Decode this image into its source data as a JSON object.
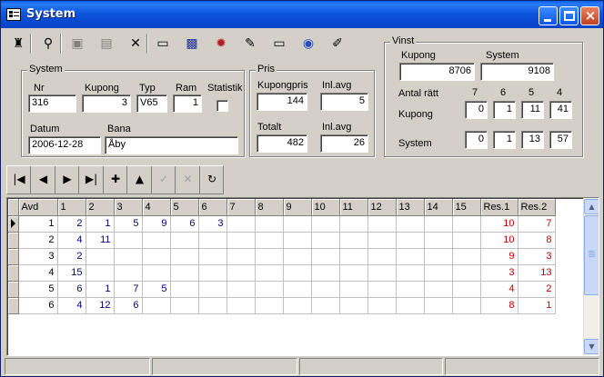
{
  "window": {
    "title": "System"
  },
  "toolbar": {
    "buttons": [
      {
        "name": "tool-icon",
        "glyph": "♜"
      },
      {
        "name": "binoculars-icon",
        "glyph": "⚲"
      },
      {
        "name": "save-icon",
        "glyph": "▣"
      },
      {
        "name": "print-icon",
        "glyph": "▤"
      },
      {
        "name": "delete-icon",
        "glyph": "✕"
      },
      {
        "name": "open-folder-icon",
        "glyph": "▭"
      },
      {
        "name": "settings-icon",
        "glyph": "▩"
      },
      {
        "name": "gear-icon",
        "glyph": "✹"
      },
      {
        "name": "pen-icon",
        "glyph": "✎"
      },
      {
        "name": "window-icon",
        "glyph": "▭"
      },
      {
        "name": "globe-icon",
        "glyph": "◉"
      },
      {
        "name": "tool2-icon",
        "glyph": "✐"
      }
    ]
  },
  "system_group": {
    "title": "System",
    "nr_label": "Nr",
    "nr_value": "316",
    "kupong_label": "Kupong",
    "kupong_value": "3",
    "typ_label": "Typ",
    "typ_value": "V65",
    "ram_label": "Ram",
    "ram_value": "1",
    "statistik_label": "Statistik",
    "datum_label": "Datum",
    "datum_value": "2006-12-28",
    "bana_label": "Bana",
    "bana_value": "Åby"
  },
  "pris_group": {
    "title": "Pris",
    "kupongpris_label": "Kupongpris",
    "kupongpris_value": "144",
    "inlavg1_label": "Inl.avg",
    "inlavg1_value": "5",
    "totalt_label": "Totalt",
    "totalt_value": "482",
    "inlavg2_label": "Inl.avg",
    "inlavg2_value": "26"
  },
  "vinst_group": {
    "title": "Vinst",
    "kupong_label": "Kupong",
    "kupong_value": "8706",
    "system_label": "System",
    "system_value": "9108",
    "antal_ratt_label": "Antal rätt",
    "col_headers": [
      "7",
      "6",
      "5",
      "4"
    ],
    "row_kupong_label": "Kupong",
    "row_kupong_values": [
      "0",
      "1",
      "11",
      "41"
    ],
    "row_system_label": "System",
    "row_system_values": [
      "0",
      "1",
      "13",
      "57"
    ]
  },
  "navigator": {
    "buttons": [
      {
        "name": "first-record-button",
        "glyph": "|◀"
      },
      {
        "name": "prior-record-button",
        "glyph": "◀"
      },
      {
        "name": "next-record-button",
        "glyph": "▶"
      },
      {
        "name": "last-record-button",
        "glyph": "▶|"
      },
      {
        "name": "insert-record-button",
        "glyph": "✚"
      },
      {
        "name": "delete-record-button",
        "glyph": "▲"
      },
      {
        "name": "post-record-button",
        "glyph": "✓"
      },
      {
        "name": "cancel-record-button",
        "glyph": "✕"
      },
      {
        "name": "refresh-record-button",
        "glyph": "↻"
      }
    ]
  },
  "grid": {
    "headers": [
      "Avd",
      "1",
      "2",
      "3",
      "4",
      "5",
      "6",
      "7",
      "8",
      "9",
      "10",
      "11",
      "12",
      "13",
      "14",
      "15",
      "Res.1",
      "Res.2"
    ],
    "rows": [
      [
        "1",
        "2",
        "1",
        "5",
        "9",
        "6",
        "3",
        "",
        "",
        "",
        "",
        "",
        "",
        "",
        "",
        "",
        "10",
        "7"
      ],
      [
        "2",
        "4",
        "11",
        "",
        "",
        "",
        "",
        "",
        "",
        "",
        "",
        "",
        "",
        "",
        "",
        "",
        "10",
        "8"
      ],
      [
        "3",
        "2",
        "",
        "",
        "",
        "",
        "",
        "",
        "",
        "",
        "",
        "",
        "",
        "",
        "",
        "",
        "9",
        "3"
      ],
      [
        "4",
        "15",
        "",
        "",
        "",
        "",
        "",
        "",
        "",
        "",
        "",
        "",
        "",
        "",
        "",
        "",
        "3",
        "13"
      ],
      [
        "5",
        "6",
        "1",
        "7",
        "5",
        "",
        "",
        "",
        "",
        "",
        "",
        "",
        "",
        "",
        "",
        "",
        "4",
        "2"
      ],
      [
        "6",
        "4",
        "12",
        "6",
        "",
        "",
        "",
        "",
        "",
        "",
        "",
        "",
        "",
        "",
        "",
        "",
        "8",
        "1"
      ]
    ]
  }
}
